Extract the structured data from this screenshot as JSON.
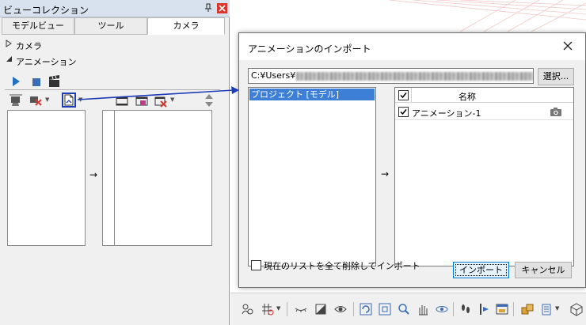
{
  "panel": {
    "title": "ビューコレクション",
    "tabs": [
      "モデルビュー",
      "ツール",
      "カメラ"
    ],
    "sections": {
      "camera": "カメラ",
      "animation": "アニメーション"
    },
    "arrow": "→"
  },
  "dialog": {
    "title": "アニメーションのインポート",
    "path_prefix": "C:¥Users¥",
    "select_button": "選択...",
    "project_item": "プロジェクト [モデル]",
    "arrow": "→",
    "column_name": "名称",
    "rows": [
      {
        "name": "アニメーション-1",
        "checked": true
      }
    ],
    "header_checked": true,
    "clear_label": "現在のリストを全て削除してインポート",
    "clear_checked": false,
    "import_button": "インポート",
    "cancel_button": "キャンセル"
  },
  "colors": {
    "accent": "#1d3db8",
    "selection": "#3d7fd6",
    "close_red": "#d9352c",
    "play_blue": "#1f6fc5"
  }
}
